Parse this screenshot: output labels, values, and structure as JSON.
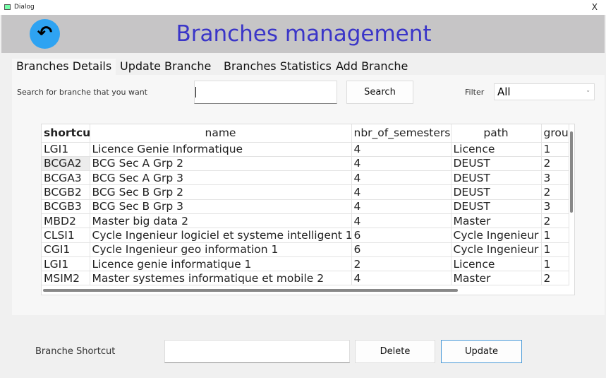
{
  "window": {
    "title": "Dialog",
    "close": "X"
  },
  "header": {
    "title": "Branches management",
    "back_icon": "back-arrow-icon",
    "colors": {
      "header_bg": "#c6c5c6",
      "title": "#3a35c8",
      "back_button": "#2ea3f2"
    }
  },
  "tabs": [
    {
      "label": "Branches Details",
      "active": true
    },
    {
      "label": "Update Branche"
    },
    {
      "label": "Branches Statistics"
    },
    {
      "label": "Add Branche"
    }
  ],
  "search": {
    "label": "Search for branche that you want",
    "value": "",
    "button": "Search"
  },
  "filter": {
    "label": "Filter",
    "selected": "All"
  },
  "table": {
    "columns": [
      "shortcut",
      "name",
      "nbr_of_semesters",
      "path",
      "grou"
    ],
    "rows": [
      [
        "LGI1",
        "Licence Genie Informatique",
        "4",
        "Licence",
        "1"
      ],
      [
        "BCGA2",
        "BCG Sec A Grp 2",
        "4",
        "DEUST",
        "2"
      ],
      [
        "BCGA3",
        "BCG Sec A Grp 3",
        "4",
        "DEUST",
        "3"
      ],
      [
        "BCGB2",
        "BCG Sec B Grp 2",
        "4",
        "DEUST",
        "2"
      ],
      [
        "BCGB3",
        "BCG Sec B Grp 3",
        "4",
        "DEUST",
        "3"
      ],
      [
        "MBD2",
        "Master big data 2",
        "4",
        "Master",
        "2"
      ],
      [
        "CLSI1",
        "Cycle Ingenieur logiciel et systeme intelligent 1",
        "6",
        "Cycle Ingenieur",
        "1"
      ],
      [
        "CGI1",
        "Cycle Ingenieur geo information 1",
        "6",
        "Cycle Ingenieur",
        "1"
      ],
      [
        "LGI1",
        "Licence genie informatique 1",
        "2",
        "Licence",
        "1"
      ],
      [
        "MSIM2",
        "Master systemes informatique et mobile 2",
        "4",
        "Master",
        "2"
      ]
    ]
  },
  "bottom": {
    "label": "Branche Shortcut",
    "value": "",
    "delete": "Delete",
    "update": "Update"
  }
}
